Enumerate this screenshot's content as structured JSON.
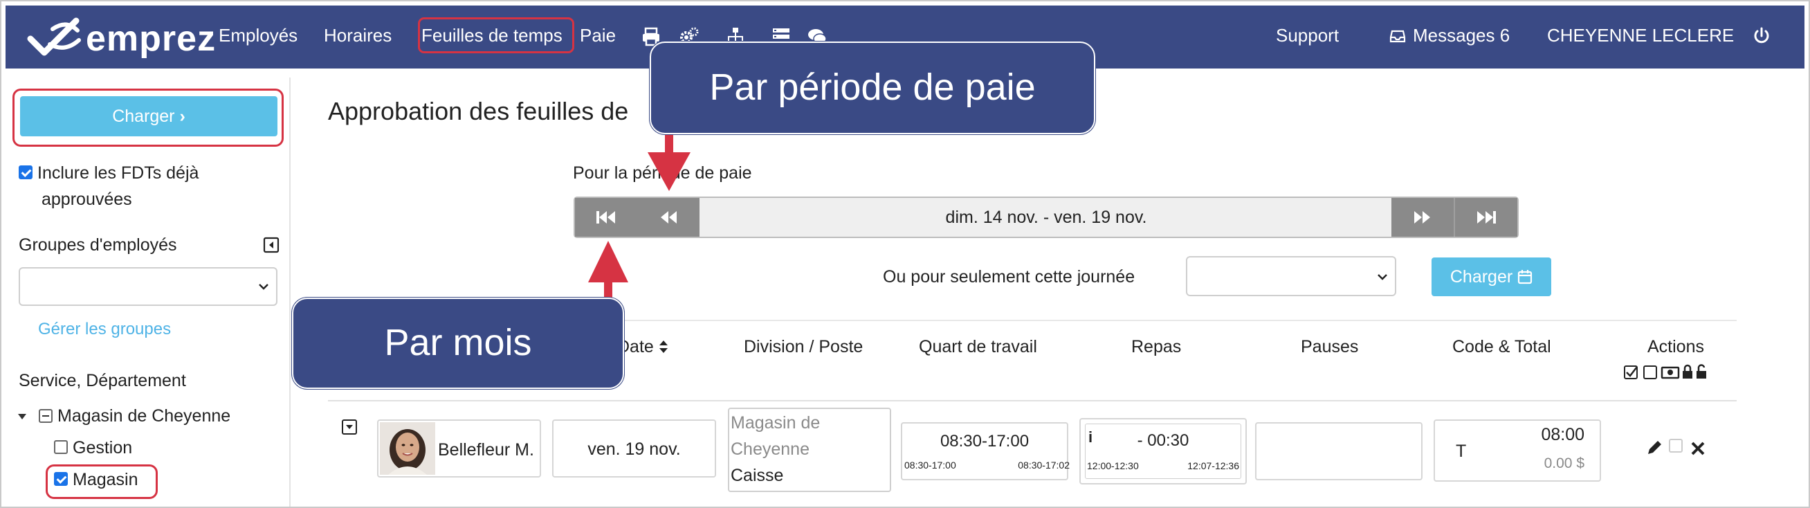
{
  "nav": {
    "brand": "emprez",
    "items": [
      "Employés",
      "Horaires",
      "Feuilles de temps",
      "Paie"
    ],
    "support": "Support",
    "messages": "Messages 6",
    "user": "CHEYENNE LECLERE"
  },
  "sidebar": {
    "load_button": "Charger",
    "include_approved": "Inclure les FDTs déjà",
    "include_approved_2": "approuvées",
    "groups_label": "Groupes d'employés",
    "manage_groups": "Gérer les groupes",
    "service_label": "Service, Département",
    "tree_root": "Magasin de Cheyenne",
    "tree_items": [
      "Gestion",
      "Magasin"
    ]
  },
  "main": {
    "title": "Approbation des feuilles de",
    "pay_period_label": "Pour la période de paie",
    "period_range": "dim. 14 nov. - ven. 19 nov.",
    "single_day_label": "Ou pour seulement cette journée",
    "load_day_button": "Charger"
  },
  "table": {
    "headers": [
      "Date",
      "Division / Poste",
      "Quart de travail",
      "Repas",
      "Pauses",
      "Code & Total",
      "Actions"
    ],
    "row": {
      "employee": "Bellefleur M.",
      "date": "ven. 19 nov.",
      "division_1": "Magasin de",
      "division_2": "Cheyenne",
      "poste": "Caisse",
      "shift": "08:30-17:00",
      "shift_planned": "08:30-17:00",
      "shift_actual": "08:30-17:02",
      "meal_icon": "i",
      "meal": "- 00:30",
      "meal_planned": "12:00-12:30",
      "meal_actual": "12:07-12:36",
      "code": "T",
      "total": "08:00",
      "amount": "0.00 $"
    }
  },
  "annotations": {
    "callout_period": "Par période de paie",
    "callout_month": "Par mois"
  },
  "colors": {
    "nav_bg": "#3a4a85",
    "accent_button": "#5bc0e7",
    "highlight_red": "#d63343",
    "arrow_red": "#d63343"
  }
}
